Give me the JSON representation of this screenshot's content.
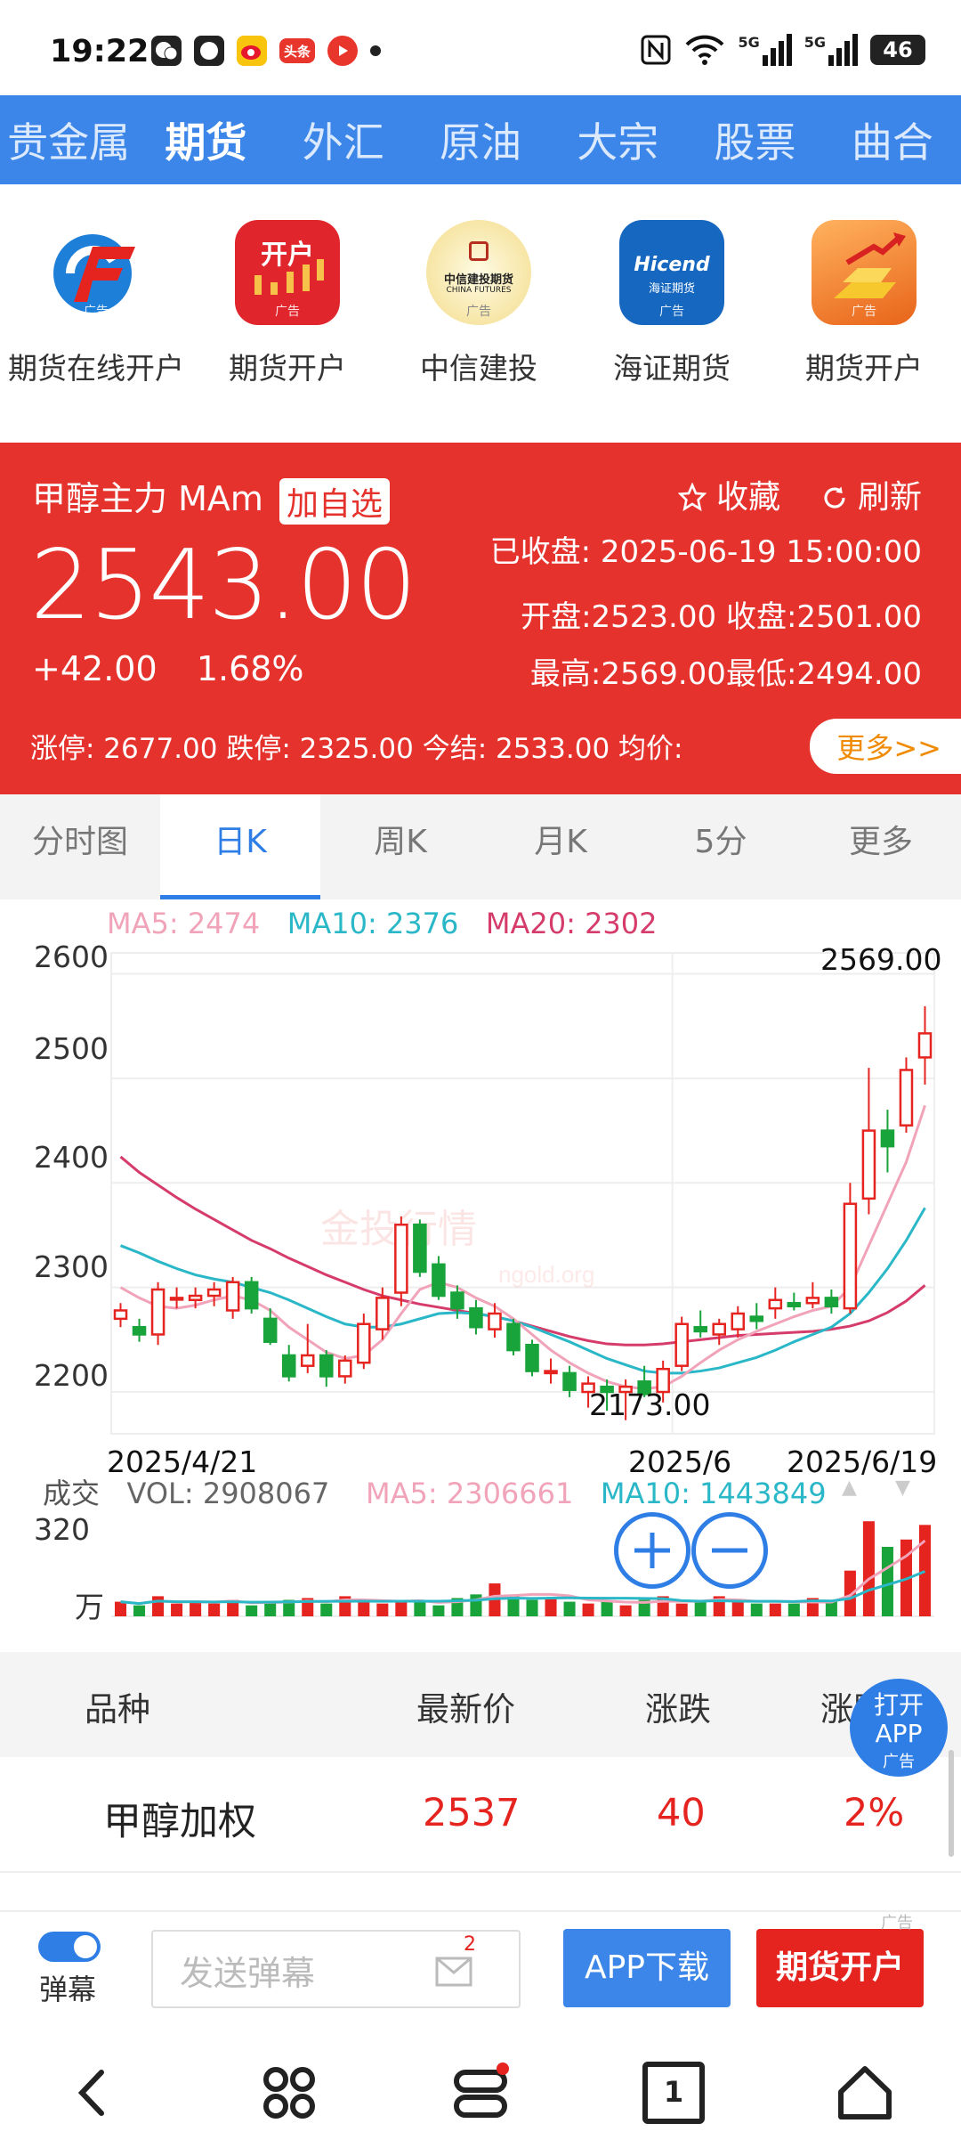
{
  "status_bar": {
    "time": "19:22",
    "battery": "46",
    "signal1": "5G",
    "signal2": "5G",
    "toutiao": "头条"
  },
  "nav": {
    "items": [
      "贵金属",
      "期货",
      "外汇",
      "原油",
      "大宗",
      "股票",
      "曲合"
    ],
    "active_index": 1
  },
  "ads": {
    "items": [
      {
        "label": "期货在线开户",
        "tag": "广告"
      },
      {
        "label": "期货开户",
        "tag": "广告",
        "icon_text": "开户"
      },
      {
        "label": "中信建投",
        "tag": "广告",
        "icon_text": "中信建投期货",
        "icon_subtext": "CHINA FUTURES"
      },
      {
        "label": "海证期货",
        "tag": "广告",
        "icon_text": "Hicend",
        "icon_subtext": "海证期货"
      },
      {
        "label": "期货开户",
        "tag": "广告"
      }
    ]
  },
  "quote": {
    "name": "甲醇主力 MAm",
    "add_label": "加自选",
    "price": "2543.00",
    "change": "+42.00",
    "change_pct": "1.68%",
    "favorite": "收藏",
    "refresh": "刷新",
    "status": "已收盘: 2025-06-19 15:00:00",
    "open_close": "开盘:2523.00 收盘:2501.00",
    "high_low": "最高:2569.00最低:2494.00",
    "limits": "涨停: 2677.00  跌停: 2325.00  今结: 2533.00  均价:",
    "more": "更多>>"
  },
  "kline_tabs": {
    "items": [
      "分时图",
      "日K",
      "周K",
      "月K",
      "5分",
      "更多"
    ],
    "active_index": 1
  },
  "chart_data": {
    "type": "candlestick",
    "ma_legend": {
      "ma5": "MA5: 2474",
      "ma10": "MA10: 2376",
      "ma20": "MA20: 2302"
    },
    "y_ticks": [
      "2600",
      "2500",
      "2400",
      "2300",
      "2200"
    ],
    "ylim": [
      2160,
      2620
    ],
    "x_labels": [
      "2025/4/21",
      "2025/6",
      "2025/6/19"
    ],
    "max_label": "2569.00",
    "min_label": "2173.00",
    "candles": [
      [
        2270,
        2285,
        2262,
        2278
      ],
      [
        2262,
        2270,
        2248,
        2255
      ],
      [
        2255,
        2305,
        2245,
        2298
      ],
      [
        2290,
        2300,
        2280,
        2290
      ],
      [
        2288,
        2300,
        2280,
        2292
      ],
      [
        2292,
        2305,
        2282,
        2298
      ],
      [
        2278,
        2310,
        2270,
        2305
      ],
      [
        2305,
        2310,
        2275,
        2280
      ],
      [
        2270,
        2280,
        2245,
        2248
      ],
      [
        2235,
        2245,
        2210,
        2215
      ],
      [
        2225,
        2265,
        2218,
        2235
      ],
      [
        2235,
        2240,
        2205,
        2215
      ],
      [
        2215,
        2235,
        2208,
        2230
      ],
      [
        2228,
        2275,
        2222,
        2265
      ],
      [
        2260,
        2300,
        2250,
        2290
      ],
      [
        2295,
        2368,
        2282,
        2360
      ],
      [
        2360,
        2365,
        2310,
        2315
      ],
      [
        2322,
        2330,
        2288,
        2292
      ],
      [
        2295,
        2302,
        2270,
        2280
      ],
      [
        2280,
        2288,
        2255,
        2262
      ],
      [
        2260,
        2285,
        2252,
        2275
      ],
      [
        2265,
        2270,
        2235,
        2240
      ],
      [
        2245,
        2250,
        2215,
        2220
      ],
      [
        2218,
        2232,
        2208,
        2220
      ],
      [
        2218,
        2225,
        2195,
        2202
      ],
      [
        2200,
        2215,
        2185,
        2208
      ],
      [
        2205,
        2212,
        2182,
        2200
      ],
      [
        2200,
        2212,
        2173,
        2205
      ],
      [
        2210,
        2225,
        2195,
        2198
      ],
      [
        2200,
        2230,
        2190,
        2222
      ],
      [
        2225,
        2272,
        2220,
        2265
      ],
      [
        2262,
        2278,
        2252,
        2258
      ],
      [
        2255,
        2270,
        2245,
        2265
      ],
      [
        2260,
        2282,
        2252,
        2275
      ],
      [
        2272,
        2285,
        2260,
        2268
      ],
      [
        2280,
        2300,
        2270,
        2288
      ],
      [
        2285,
        2295,
        2278,
        2282
      ],
      [
        2285,
        2305,
        2280,
        2290
      ],
      [
        2290,
        2298,
        2275,
        2282
      ],
      [
        2280,
        2400,
        2275,
        2380
      ],
      [
        2385,
        2510,
        2370,
        2450
      ],
      [
        2450,
        2470,
        2410,
        2435
      ],
      [
        2455,
        2520,
        2448,
        2508
      ],
      [
        2520,
        2569,
        2494,
        2543
      ]
    ],
    "ma5": [
      2300,
      2290,
      2282,
      2280,
      2283,
      2288,
      2292,
      2288,
      2278,
      2262,
      2250,
      2238,
      2232,
      2235,
      2250,
      2275,
      2298,
      2305,
      2300,
      2290,
      2282,
      2270,
      2255,
      2240,
      2228,
      2218,
      2210,
      2205,
      2203,
      2205,
      2215,
      2228,
      2240,
      2250,
      2258,
      2265,
      2272,
      2278,
      2282,
      2300,
      2340,
      2380,
      2420,
      2474
    ],
    "ma10": [
      2340,
      2333,
      2325,
      2318,
      2312,
      2308,
      2305,
      2300,
      2295,
      2288,
      2280,
      2272,
      2265,
      2262,
      2262,
      2265,
      2270,
      2275,
      2276,
      2275,
      2272,
      2268,
      2262,
      2255,
      2248,
      2240,
      2232,
      2226,
      2220,
      2218,
      2218,
      2220,
      2223,
      2228,
      2233,
      2240,
      2248,
      2255,
      2262,
      2275,
      2295,
      2318,
      2345,
      2376
    ],
    "ma20": [
      2425,
      2410,
      2398,
      2386,
      2375,
      2365,
      2355,
      2345,
      2337,
      2328,
      2320,
      2312,
      2305,
      2298,
      2292,
      2288,
      2284,
      2281,
      2278,
      2275,
      2272,
      2268,
      2263,
      2258,
      2253,
      2249,
      2246,
      2245,
      2245,
      2246,
      2248,
      2250,
      2252,
      2254,
      2255,
      2256,
      2257,
      2258,
      2260,
      2263,
      2268,
      2276,
      2287,
      2302
    ],
    "volume": {
      "label": "成交",
      "vol": "VOL: 2908067",
      "ma5": "MA5: 2306661",
      "ma10": "MA10: 1443849",
      "y_top": "320",
      "unit": "万",
      "bars": [
        0.8,
        0.6,
        1.1,
        0.7,
        0.8,
        0.7,
        0.9,
        0.6,
        0.8,
        0.9,
        1.0,
        0.7,
        1.1,
        0.8,
        0.7,
        0.8,
        0.9,
        0.6,
        1.0,
        1.2,
        1.8,
        1.1,
        0.9,
        1.0,
        0.8,
        0.7,
        0.8,
        0.6,
        0.9,
        1.1,
        0.7,
        0.8,
        1.1,
        0.8,
        0.7,
        0.7,
        0.7,
        1.0,
        0.8,
        2.5,
        5.2,
        3.8,
        4.2,
        5.0
      ]
    }
  },
  "table": {
    "headers": [
      "品种",
      "最新价",
      "涨跌",
      "涨跌"
    ],
    "rows": [
      {
        "name": "甲醇加权",
        "price": "2537",
        "change": "40",
        "pct": "2%"
      }
    ]
  },
  "open_app": {
    "line1": "打开",
    "line2": "APP",
    "tag": "广告"
  },
  "danmu": {
    "label": "弹幕",
    "placeholder": "发送弹幕",
    "badge": "2",
    "app_download": "APP下载",
    "futures_open": "期货开户",
    "ad_tag": "广告"
  },
  "bottom_nav": {
    "tab_count": "1"
  },
  "colors": {
    "up": "#e5231f",
    "down": "#18a33b",
    "accent": "#2f7ee6",
    "ma5": "#f1a3b9",
    "ma10": "#2ab7c7",
    "ma20": "#d63c6b"
  }
}
